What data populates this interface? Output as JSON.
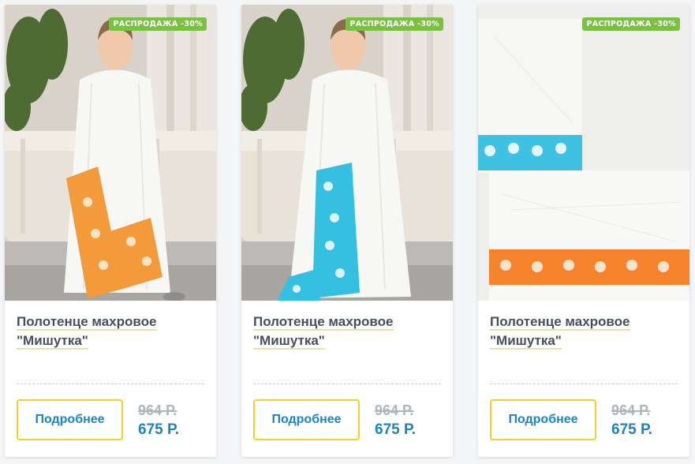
{
  "colors": {
    "badge_bg": "#7ac142",
    "button_border": "#f4ce2a",
    "accent_blue": "#1e84c6",
    "old_price": "#b0b6bd",
    "title_text": "#46505c"
  },
  "products": [
    {
      "badge": "РАСПРОДАЖА -30%",
      "title": "Полотенце махровое \"Мишутка\"",
      "button": "Подробнее",
      "old_price": "964 Р.",
      "new_price": "675 Р.",
      "image_icon": "boy-in-orange-trim-towel-photo"
    },
    {
      "badge": "РАСПРОДАЖА -30%",
      "title": "Полотенце махровое \"Мишутка\"",
      "button": "Подробнее",
      "old_price": "964 Р.",
      "new_price": "675 Р.",
      "image_icon": "boy-in-blue-trim-towel-photo"
    },
    {
      "badge": "РАСПРОДАЖА -30%",
      "title": "Полотенце махровое \"Мишутка\"",
      "button": "Подробнее",
      "old_price": "964 Р.",
      "new_price": "675 Р.",
      "image_icon": "folded-towels-photo"
    }
  ]
}
